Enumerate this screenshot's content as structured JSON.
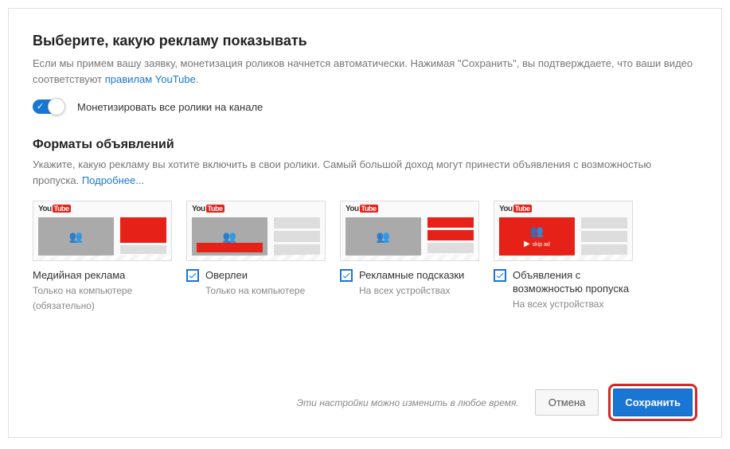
{
  "header": {
    "title": "Выберите, какую рекламу показывать",
    "desc_part1": "Если мы примем вашу заявку, монетизация роликов начнется автоматически. Нажимая \"Сохранить\", вы подтверждаете, что ваши видео соответствуют ",
    "desc_link": "правилам YouTube",
    "desc_part2": "."
  },
  "toggle": {
    "label": "Монетизировать все ролики на канале",
    "checked": true
  },
  "formats_section": {
    "title": "Форматы объявлений",
    "desc_part1": "Укажите, какую рекламу вы хотите включить в свои ролики. Самый большой доход могут принести объявления с возможностью пропуска. ",
    "desc_link": "Подробнее..."
  },
  "formats": [
    {
      "name": "Медийная реклама",
      "sub1": "Только на компьютере",
      "sub2": "(обязательно)",
      "has_checkbox": false
    },
    {
      "name": "Оверлеи",
      "sub1": "Только на компьютере",
      "sub2": "",
      "has_checkbox": true,
      "checked": true
    },
    {
      "name": "Рекламные подсказки",
      "sub1": "На всех устройствах",
      "sub2": "",
      "has_checkbox": true,
      "checked": true
    },
    {
      "name": "Объявления с возможностью пропуска",
      "sub1": "На всех устройствах",
      "sub2": "",
      "has_checkbox": true,
      "checked": true
    }
  ],
  "thumb_labels": {
    "skip_ad": "skip ad"
  },
  "footer": {
    "note": "Эти настройки можно изменить в любое время.",
    "cancel": "Отмена",
    "save": "Сохранить"
  }
}
